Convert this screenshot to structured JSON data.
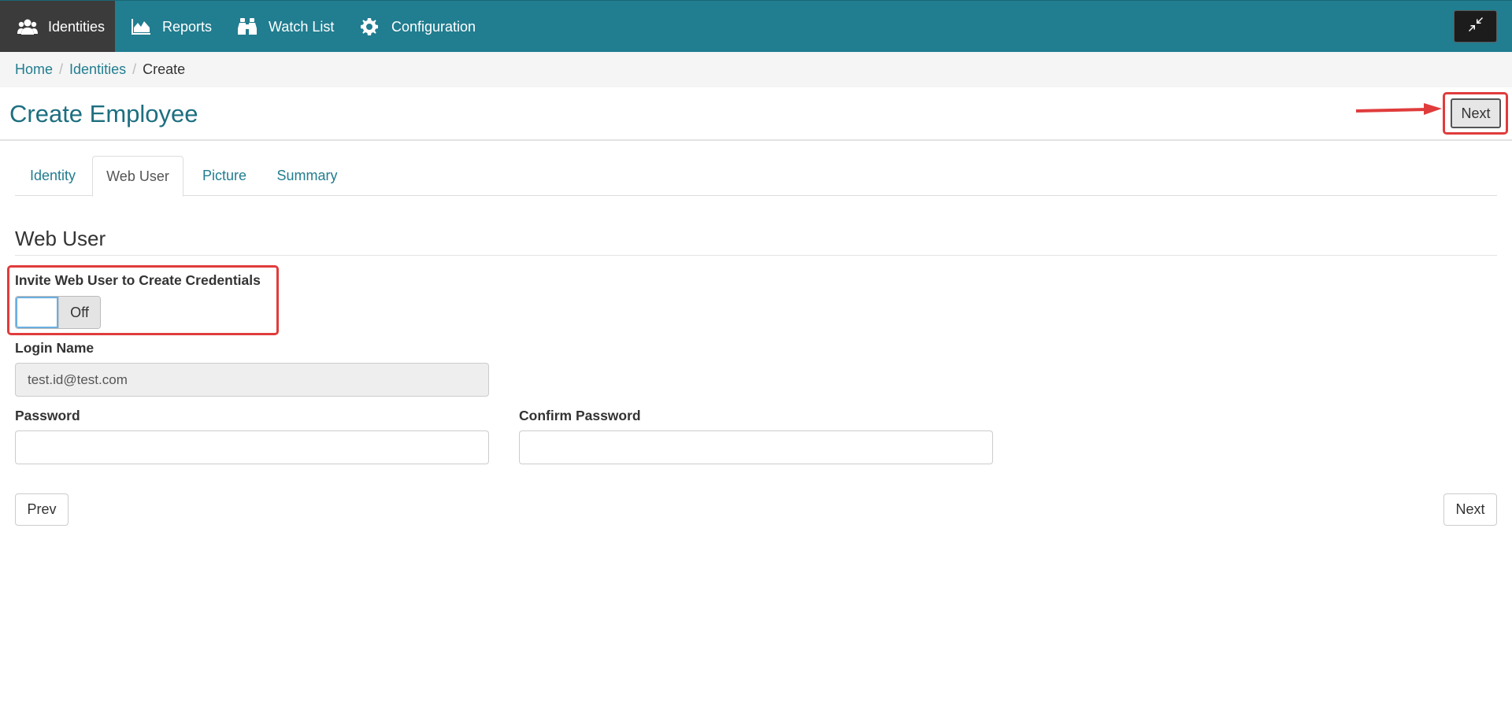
{
  "navbar": {
    "items": [
      {
        "label": "Identities",
        "icon": "users-icon",
        "active": true
      },
      {
        "label": "Reports",
        "icon": "area-chart-icon",
        "active": false
      },
      {
        "label": "Watch List",
        "icon": "binoculars-icon",
        "active": false
      },
      {
        "label": "Configuration",
        "icon": "gear-icon",
        "active": false
      }
    ],
    "collapse_icon": "compress-icon",
    "color": "#217d90"
  },
  "breadcrumb": {
    "home": "Home",
    "sep": "/",
    "identities": "Identities",
    "current": "Create"
  },
  "page": {
    "title": "Create Employee",
    "next_label": "Next"
  },
  "tabs": [
    {
      "label": "Identity",
      "active": false
    },
    {
      "label": "Web User",
      "active": true
    },
    {
      "label": "Picture",
      "active": false
    },
    {
      "label": "Summary",
      "active": false
    }
  ],
  "section": {
    "title": "Web User"
  },
  "form": {
    "invite_label": "Invite Web User to Create Credentials",
    "invite_toggle_state": "Off",
    "login_label": "Login Name",
    "login_value": "test.id@test.com",
    "password_label": "Password",
    "password_value": "",
    "confirm_label": "Confirm Password",
    "confirm_value": ""
  },
  "footer": {
    "prev_label": "Prev",
    "next_label": "Next"
  },
  "annotations": {
    "highlight_color": "#e03c3c"
  }
}
